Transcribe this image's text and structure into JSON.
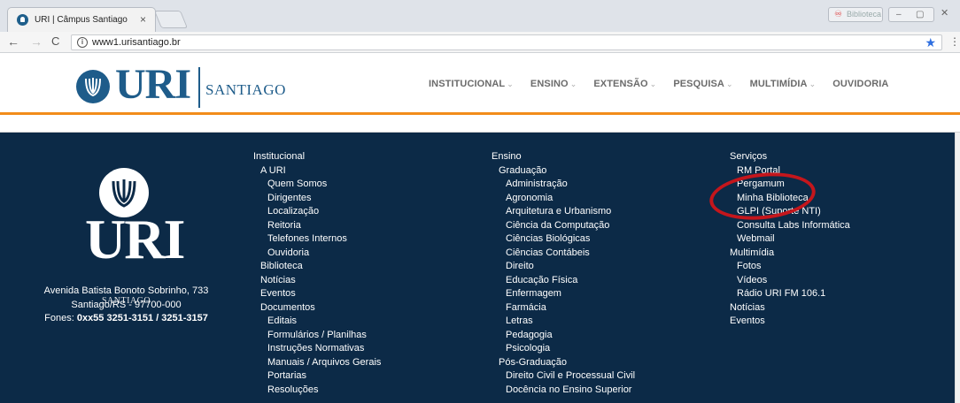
{
  "browser": {
    "tab_title": "URI | Câmpus Santiago",
    "tab_close": "×",
    "extension_label": "Biblioteca",
    "url": "www1.urisantiago.br",
    "back": "←",
    "forward": "→",
    "reload": "C",
    "star": "★",
    "menu": "⋮",
    "win_minimize": "–",
    "win_maximize": "▢",
    "win_close": "✕"
  },
  "header": {
    "logo_text": "URI",
    "logo_subtext": "SANTIAGO",
    "nav": [
      {
        "label": "INSTITUCIONAL",
        "dropdown": "⌄"
      },
      {
        "label": "ENSINO",
        "dropdown": "⌄"
      },
      {
        "label": "EXTENSÃO",
        "dropdown": "⌄"
      },
      {
        "label": "PESQUISA",
        "dropdown": "⌄"
      },
      {
        "label": "MULTIMÍDIA",
        "dropdown": "⌄"
      },
      {
        "label": "OUVIDORIA",
        "dropdown": ""
      }
    ]
  },
  "footer": {
    "logo_text": "URI",
    "logo_subtext": "SANTIAGO",
    "address_line1": "Avenida Batista Bonoto Sobrinho, 733",
    "address_line2": "Santiago/RS - 97700-000",
    "phones_label": "Fones:",
    "phones_value": "0xx55 3251-3151 / 3251-3157",
    "col1": [
      "Institucional",
      "A URI",
      "Quem Somos",
      "Dirigentes",
      "Localização",
      "Reitoria",
      "Telefones Internos",
      "Ouvidoria",
      "Biblioteca",
      "Notícias",
      "Eventos",
      "Documentos",
      "Editais",
      "Formulários / Planilhas",
      "Instruções Normativas",
      "Manuais / Arquivos Gerais",
      "Portarias",
      "Resoluções"
    ],
    "col2": [
      "Ensino",
      "Graduação",
      "Administração",
      "Agronomia",
      "Arquitetura e Urbanismo",
      "Ciência da Computação",
      "Ciências Biológicas",
      "Ciências Contábeis",
      "Direito",
      "Educação Física",
      "Enfermagem",
      "Farmácia",
      "Letras",
      "Pedagogia",
      "Psicologia",
      "Pós-Graduação",
      "Direito Civil e Processual Civil",
      "Docência no Ensino Superior"
    ],
    "col3": [
      "Serviços",
      "RM Portal",
      "Pergamum",
      "Minha Biblioteca",
      "GLPI (Suporte NTI)",
      "Consulta Labs Informática",
      "Webmail",
      "Multimídia",
      "Fotos",
      "Vídeos",
      "Rádio URI FM 106.1",
      "Notícias",
      "Eventos"
    ]
  },
  "colors": {
    "brand_blue": "#1e5c8a",
    "footer_bg": "#0c2a47",
    "accent_orange": "#f28c1b",
    "highlight_red": "#c4161c"
  }
}
